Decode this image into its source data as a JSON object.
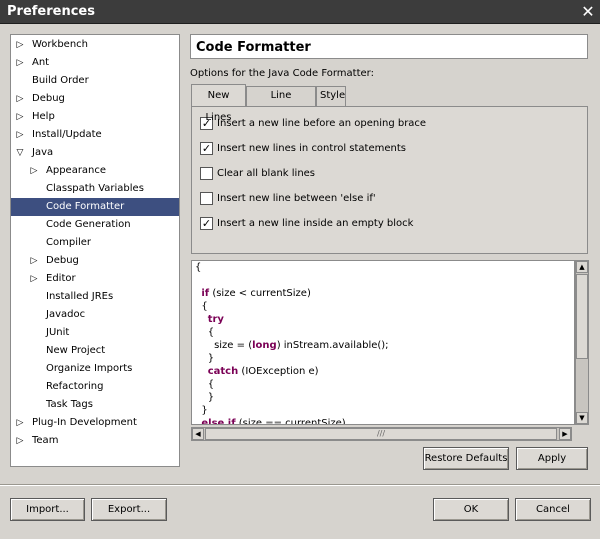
{
  "window": {
    "title": "Preferences",
    "close_glyph": "✕"
  },
  "tree": {
    "items": [
      {
        "label": "Workbench",
        "expander": "▷",
        "level": 0
      },
      {
        "label": "Ant",
        "expander": "▷",
        "level": 0
      },
      {
        "label": "Build Order",
        "expander": "",
        "level": 0
      },
      {
        "label": "Debug",
        "expander": "▷",
        "level": 0
      },
      {
        "label": "Help",
        "expander": "▷",
        "level": 0
      },
      {
        "label": "Install/Update",
        "expander": "▷",
        "level": 0
      },
      {
        "label": "Java",
        "expander": "▽",
        "level": 0
      },
      {
        "label": "Appearance",
        "expander": "▷",
        "level": 1
      },
      {
        "label": "Classpath Variables",
        "expander": "",
        "level": 1
      },
      {
        "label": "Code Formatter",
        "expander": "",
        "level": 1,
        "selected": true
      },
      {
        "label": "Code Generation",
        "expander": "",
        "level": 1
      },
      {
        "label": "Compiler",
        "expander": "",
        "level": 1
      },
      {
        "label": "Debug",
        "expander": "▷",
        "level": 1
      },
      {
        "label": "Editor",
        "expander": "▷",
        "level": 1
      },
      {
        "label": "Installed JREs",
        "expander": "",
        "level": 1
      },
      {
        "label": "Javadoc",
        "expander": "",
        "level": 1
      },
      {
        "label": "JUnit",
        "expander": "",
        "level": 1
      },
      {
        "label": "New Project",
        "expander": "",
        "level": 1
      },
      {
        "label": "Organize Imports",
        "expander": "",
        "level": 1
      },
      {
        "label": "Refactoring",
        "expander": "",
        "level": 1
      },
      {
        "label": "Task Tags",
        "expander": "",
        "level": 1
      },
      {
        "label": "Plug-In Development",
        "expander": "▷",
        "level": 0
      },
      {
        "label": "Team",
        "expander": "▷",
        "level": 0
      }
    ]
  },
  "page": {
    "title": "Code Formatter",
    "options_label": "Options for the Java Code Formatter:",
    "tabs": [
      "New Lines",
      "Line Splitting",
      "Style"
    ],
    "checkboxes": [
      {
        "label": "Insert a new line before an opening brace",
        "checked": true
      },
      {
        "label": "Insert new lines in control statements",
        "checked": true
      },
      {
        "label": "Clear all blank lines",
        "checked": false
      },
      {
        "label": "Insert new line between 'else if'",
        "checked": false
      },
      {
        "label": "Insert a new line inside an empty block",
        "checked": true
      }
    ],
    "check_glyph": "✓",
    "code_lines": [
      [
        {
          "t": "{"
        }
      ],
      [
        {
          "t": ""
        }
      ],
      [
        {
          "t": "  "
        },
        {
          "t": "if",
          "kw": true
        },
        {
          "t": " (size < currentSize)"
        }
      ],
      [
        {
          "t": "  {"
        }
      ],
      [
        {
          "t": "    "
        },
        {
          "t": "try",
          "kw": true
        }
      ],
      [
        {
          "t": "    {"
        }
      ],
      [
        {
          "t": "      size = ("
        },
        {
          "t": "long",
          "kw": true
        },
        {
          "t": ") inStream.available();"
        }
      ],
      [
        {
          "t": "    }"
        }
      ],
      [
        {
          "t": "    "
        },
        {
          "t": "catch",
          "kw": true
        },
        {
          "t": " (IOException e)"
        }
      ],
      [
        {
          "t": "    {"
        }
      ],
      [
        {
          "t": "    }"
        }
      ],
      [
        {
          "t": "  }"
        }
      ],
      [
        {
          "t": "  "
        },
        {
          "t": "else if",
          "kw": true
        },
        {
          "t": " (size == currentSize)"
        }
      ]
    ],
    "restore_defaults_label": "Restore Defaults",
    "apply_label": "Apply"
  },
  "footer": {
    "import_label": "Import...",
    "export_label": "Export...",
    "ok_label": "OK",
    "cancel_label": "Cancel"
  },
  "scroll": {
    "up": "▲",
    "down": "▼",
    "left": "◀",
    "right": "▶",
    "grip_v": "≡",
    "grip_h": "///"
  }
}
